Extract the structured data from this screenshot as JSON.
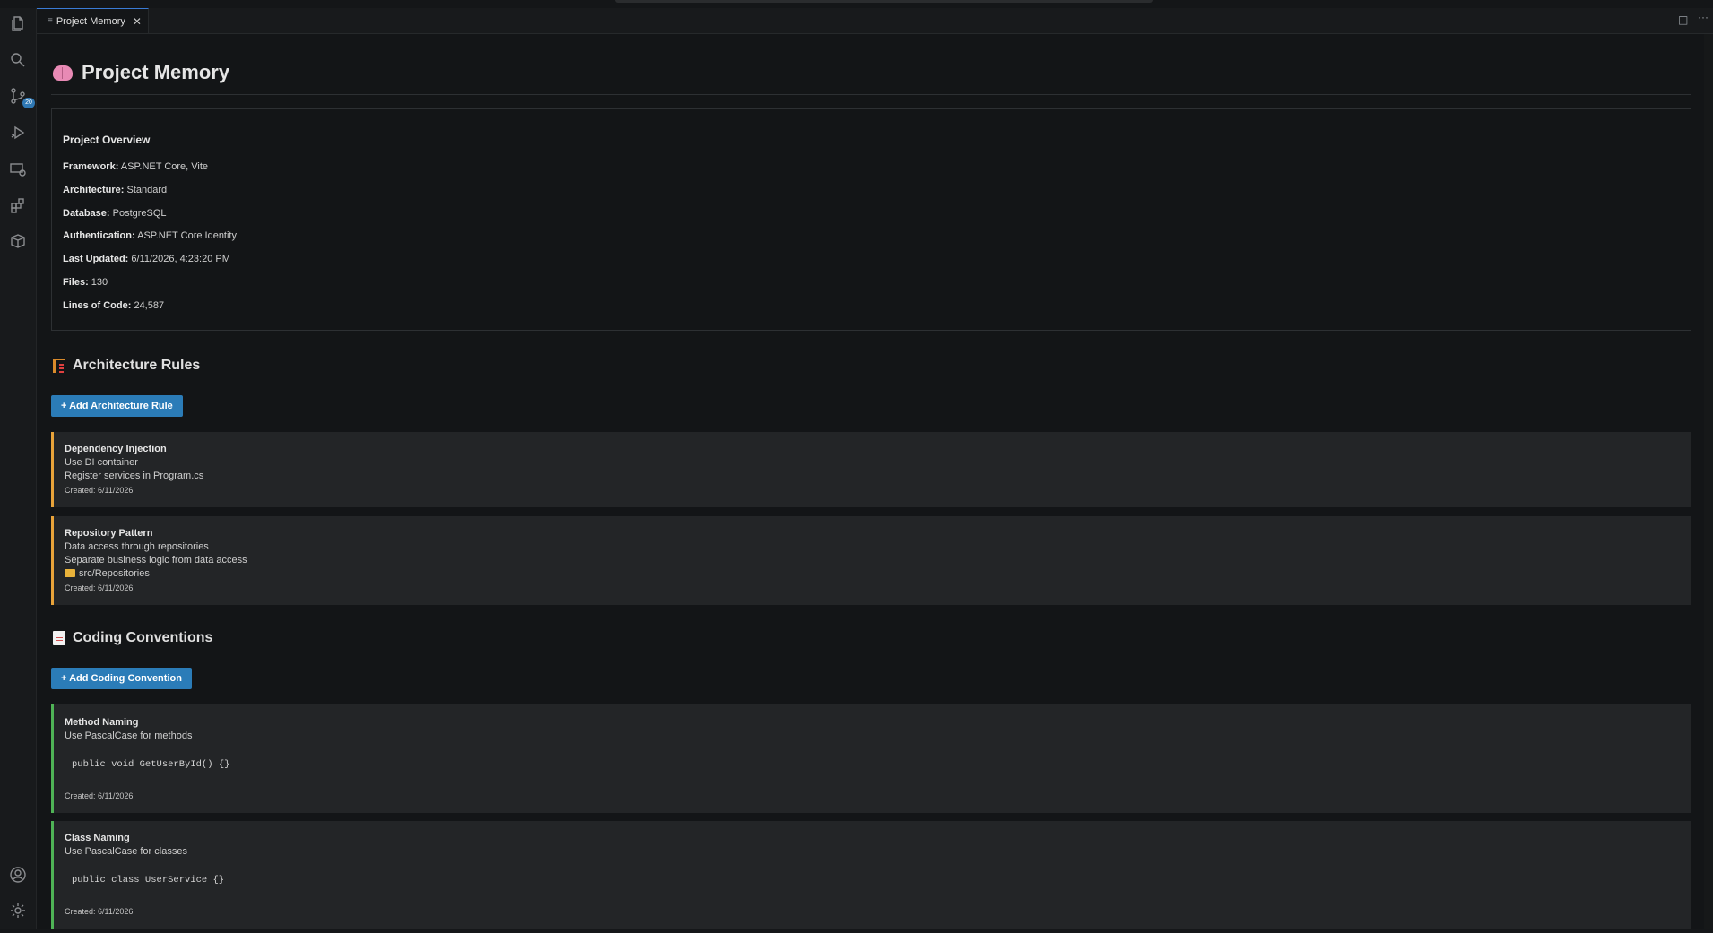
{
  "tab": {
    "label": "Project Memory",
    "close": "✕"
  },
  "activity_badge": "20",
  "page": {
    "title": "Project Memory"
  },
  "overview": {
    "heading": "Project Overview",
    "fields": [
      {
        "label": "Framework:",
        "value": " ASP.NET Core, Vite"
      },
      {
        "label": "Architecture:",
        "value": " Standard"
      },
      {
        "label": "Database:",
        "value": " PostgreSQL"
      },
      {
        "label": "Authentication:",
        "value": " ASP.NET Core Identity"
      },
      {
        "label": "Last Updated:",
        "value": " 6/11/2026, 4:23:20 PM"
      },
      {
        "label": "Files:",
        "value": " 130"
      },
      {
        "label": "Lines of Code:",
        "value": " 24,587"
      }
    ]
  },
  "architecture": {
    "heading": "Architecture Rules",
    "add_button": "+ Add Architecture Rule",
    "rules": [
      {
        "title": "Dependency Injection",
        "desc": "Use DI container",
        "detail": "Register services in Program.cs",
        "created": "Created: 6/11/2026"
      },
      {
        "title": "Repository Pattern",
        "desc": "Data access through repositories",
        "detail": "Separate business logic from data access",
        "path": "src/Repositories",
        "created": "Created: 6/11/2026"
      }
    ]
  },
  "conventions": {
    "heading": "Coding Conventions",
    "add_button": "+ Add Coding Convention",
    "items": [
      {
        "title": "Method Naming",
        "desc": "Use PascalCase for methods",
        "code": "public void GetUserById() {}",
        "created": "Created: 6/11/2026"
      },
      {
        "title": "Class Naming",
        "desc": "Use PascalCase for classes",
        "code": "public class UserService {}",
        "created": "Created: 6/11/2026"
      }
    ]
  },
  "colors": {
    "accent_button": "#2b7cb8",
    "rule_border": "#e8a33a",
    "convention_border": "#4fb356"
  }
}
